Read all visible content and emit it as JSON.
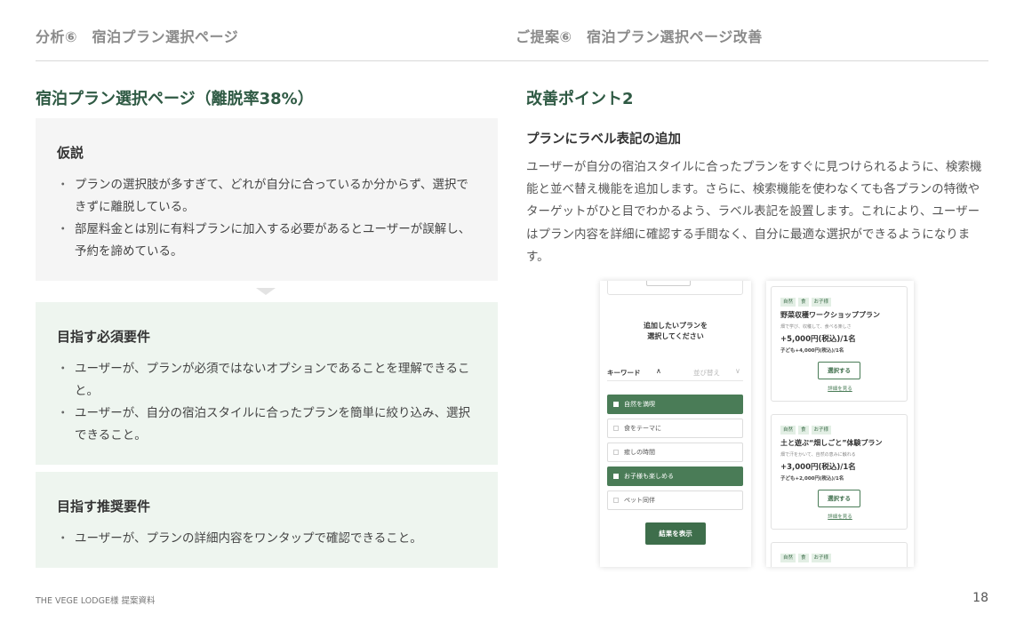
{
  "header": {
    "left": "分析⑥　宿泊プラン選択ページ",
    "right": "ご提案⑥　宿泊プラン選択ページ改善"
  },
  "left": {
    "title": "宿泊プラン選択ページ（離脱率38%）",
    "hypothesis": {
      "heading": "仮説",
      "items": [
        "プランの選択肢が多すぎて、どれが自分に合っているか分からず、選択できずに離脱している。",
        "部屋料金とは別に有料プランに加入する必要があるとユーザーが誤解し、予約を諦めている。"
      ]
    },
    "required": {
      "heading": "目指す必須要件",
      "items": [
        "ユーザーが、プランが必須ではないオプションであることを理解できること。",
        "ユーザーが、自分の宿泊スタイルに合ったプランを簡単に絞り込み、選択できること。"
      ]
    },
    "recommended": {
      "heading": "目指す推奨要件",
      "items": [
        "ユーザーが、プランの詳細内容をワンタップで確認できること。"
      ]
    }
  },
  "right": {
    "title": "改善ポイント2",
    "subtitle": "プランにラベル表記の追加",
    "body": "ユーザーが自分の宿泊スタイルに合ったプランをすぐに見つけられるように、検索機能と並べ替え機能を追加します。さらに、検索機能を使わなくても各プランの特徴やターゲットがひと目でわかるよう、ラベル表記を設置します。これにより、ユーザーはプラン内容を詳細に確認する手間なく、自分に最適な選択ができるようになります。"
  },
  "mock_left": {
    "prompt_line1": "追加したいプランを",
    "prompt_line2": "選択してください",
    "keyword_label": "キーワード",
    "keyword_caret": "∧",
    "sort_label": "並び替え",
    "sort_caret": "∨",
    "filters": [
      {
        "label": "自然を満喫",
        "checked": true
      },
      {
        "label": "食をテーマに",
        "checked": false
      },
      {
        "label": "癒しの時間",
        "checked": false
      },
      {
        "label": "お子様も楽しめる",
        "checked": true
      },
      {
        "label": "ペット同伴",
        "checked": false
      }
    ],
    "result_button": "結果を表示"
  },
  "mock_right": {
    "cards": [
      {
        "tags": [
          "自然",
          "食",
          "お子様"
        ],
        "name": "野菜収穫ワークショッププラン",
        "desc": "畑で学び、収穫して、食べる楽しさ",
        "price": "+5,000円(税込)/1名",
        "kids": "子ども+4,000円(税込)/1名",
        "button": "選択する",
        "link": "詳細を見る"
      },
      {
        "tags": [
          "自然",
          "食",
          "お子様"
        ],
        "name": "土と遊ぶ“畑しごと”体験プラン",
        "desc": "畑で汗をかいて、自然の恵みに触れる",
        "price": "+3,000円(税込)/1名",
        "kids": "子ども+2,000円(税込)/1名",
        "button": "選択する",
        "link": "詳細を見る"
      },
      {
        "tags": [
          "自然",
          "食",
          "お子様"
        ]
      }
    ]
  },
  "footer": {
    "company": "THE VEGE LODGE様 提案資料",
    "page": "18"
  },
  "colors": {
    "accent_green": "#3e6e4b",
    "title_green": "#2f5a44",
    "panel_gray": "#f5f5f5",
    "panel_green": "#eef5ef"
  }
}
